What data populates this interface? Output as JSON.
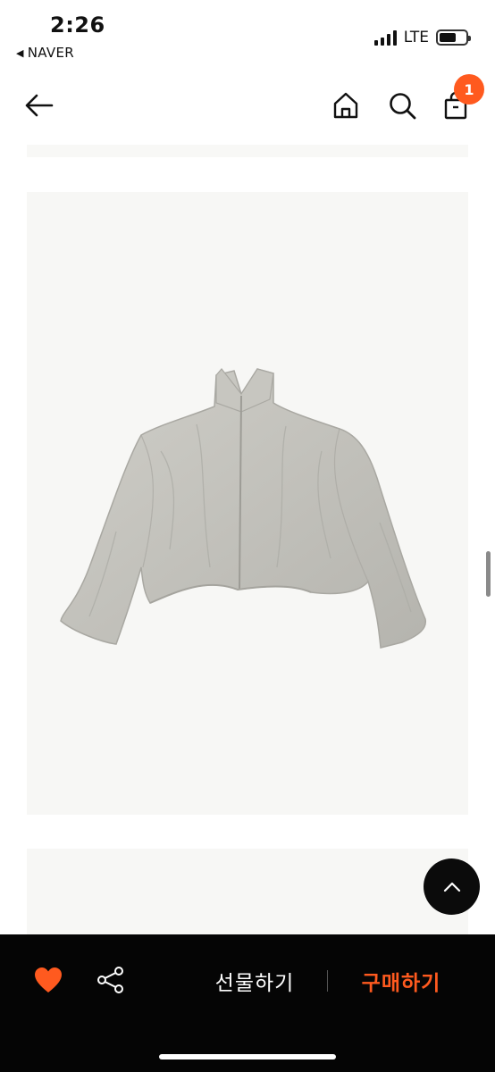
{
  "status_bar": {
    "time": "2:26",
    "back_app": "NAVER",
    "network": "LTE",
    "battery_level": 0.65
  },
  "header": {
    "back_icon": "arrow-left-icon",
    "home_icon": "home-icon",
    "search_icon": "search-icon",
    "bag_icon": "shopping-bag-icon",
    "cart_count": "1"
  },
  "product": {
    "image_subject": "jacket",
    "image_background": "#f7f7f5"
  },
  "bottom_bar": {
    "gift_label": "선물하기",
    "buy_label": "구매하기",
    "wishlist_icon": "heart-icon",
    "share_icon": "share-icon"
  },
  "colors": {
    "accent": "#ff5a1f",
    "bar_background": "#050505",
    "heart": "#ff5a1f"
  }
}
